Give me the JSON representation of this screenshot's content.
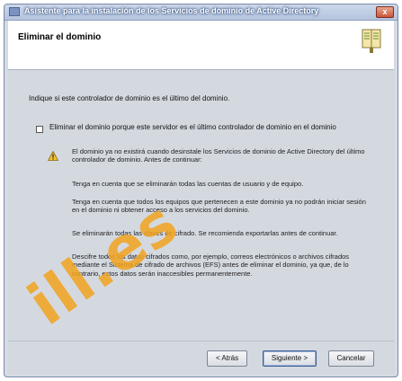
{
  "window": {
    "title": "Asistente para la instalación de los Servicios de dominio de Active Directory",
    "close_glyph": "x",
    "close_icon": "close-icon"
  },
  "header": {
    "title": "Eliminar el dominio",
    "icon": "book-icon"
  },
  "content": {
    "intro": "Indique si este controlador de dominio es el último del dominio.",
    "checkbox": {
      "label": "Eliminar el dominio porque este servidor es el último controlador de dominio en el dominio",
      "checked": false
    },
    "warning_icon": "warning-icon",
    "paragraphs": [
      "El dominio ya no existirá cuando desinstale los Servicios de dominio de Active Directory del último controlador de dominio. Antes de continuar:",
      "Tenga en cuenta que se eliminarán todas las cuentas de usuario y de equipo.",
      "Tenga en cuenta que todos los equipos que pertenecen a este dominio ya no podrán iniciar sesión en el dominio ni obtener acceso a los servicios del dominio.",
      "Se eliminarán todas las claves de cifrado. Se recomienda exportarlas antes de continuar.",
      "Descifre todos los datos cifrados como, por ejemplo, correos electrónicos o archivos cifrados mediante el Sistema de cifrado de archivos (EFS) antes de eliminar el dominio, ya que, de lo contrario, estos datos serán inaccesibles permanentemente."
    ]
  },
  "footer": {
    "back_label": "< Atrás",
    "next_label": "Siguiente >",
    "cancel_label": "Cancelar"
  },
  "watermark": "ill.es",
  "colors": {
    "accent": "#3c5b8e",
    "watermark": "#f2a41f",
    "warning": "#f2c230"
  }
}
